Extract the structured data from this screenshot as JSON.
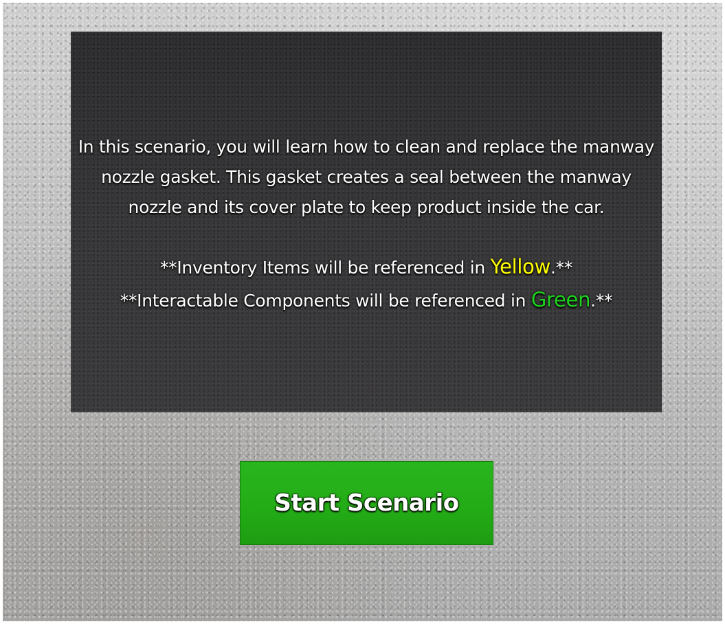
{
  "intro": {
    "lines": [
      "In this scenario, you will learn how to clean and replace the manway",
      "nozzle gasket. This gasket creates a seal between the manway",
      "nozzle and its cover plate to keep product inside the car."
    ]
  },
  "notes": {
    "inventory": {
      "prefix": "**Inventory Items will be referenced in ",
      "keyword": "Yellow",
      "suffix": ".**"
    },
    "interactable": {
      "prefix": "**Interactable Components will be referenced in ",
      "keyword": "Green",
      "suffix": ".**"
    }
  },
  "start_button": {
    "label": "Start Scenario"
  },
  "colors": {
    "panel_background": "#333234",
    "inventory_highlight": "#ffff00",
    "interactable_highlight": "#1ed21e",
    "button_green": "#23ab16"
  }
}
